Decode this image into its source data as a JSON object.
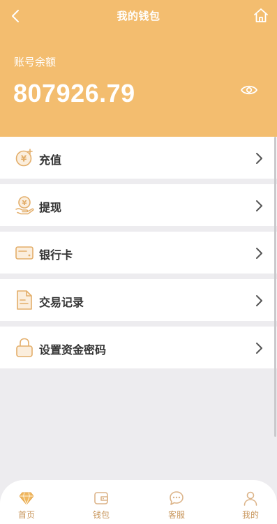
{
  "header": {
    "title": "我的钱包",
    "balance_label": "账号余额",
    "balance_value": "807926.79"
  },
  "menu": {
    "items": [
      {
        "label": "充值",
        "icon": "yen-coin-plus-icon"
      },
      {
        "label": "提现",
        "icon": "yen-hand-icon"
      },
      {
        "label": "银行卡",
        "icon": "bank-card-icon"
      },
      {
        "label": "交易记录",
        "icon": "document-icon"
      },
      {
        "label": "设置资金密码",
        "icon": "lock-icon"
      }
    ]
  },
  "bottom_nav": {
    "items": [
      {
        "label": "首页",
        "icon": "diamond-icon"
      },
      {
        "label": "钱包",
        "icon": "wallet-icon"
      },
      {
        "label": "客服",
        "icon": "chat-icon"
      },
      {
        "label": "我的",
        "icon": "user-icon"
      }
    ]
  },
  "colors": {
    "header_bg": "#f3bd6f",
    "accent": "#c8965b",
    "icon_gold": "#e3ae6a"
  }
}
